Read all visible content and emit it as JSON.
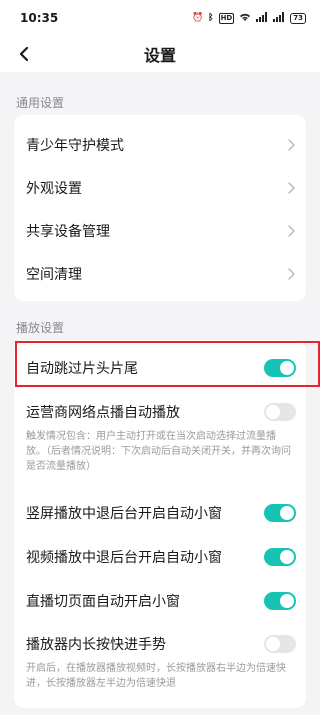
{
  "status_bar": {
    "time": "10:35",
    "net_speed": "HD",
    "signal1": "5G",
    "signal2": "5G",
    "battery": "73"
  },
  "nav": {
    "title": "设置"
  },
  "general": {
    "section_label": "通用设置",
    "items": [
      {
        "label": "青少年守护模式"
      },
      {
        "label": "外观设置"
      },
      {
        "label": "共享设备管理"
      },
      {
        "label": "空间清理"
      }
    ]
  },
  "playback": {
    "section_label": "播放设置",
    "items": [
      {
        "label": "自动跳过片头片尾",
        "on": true
      },
      {
        "label": "运营商网络点播自动播放",
        "on": false,
        "desc": "触发情况包含：用户主动打开或在当次启动选择过流量播放。（后者情况说明：下次启动后自动关闭开关，并再次询问是否流量播放）"
      },
      {
        "label": "竖屏播放中退后台开启自动小窗",
        "on": true
      },
      {
        "label": "视频播放中退后台开启自动小窗",
        "on": true
      },
      {
        "label": "直播切页面自动开启小窗",
        "on": true
      },
      {
        "label": "播放器内长按快进手势",
        "on": false,
        "desc": "开启后，在播放器播放视频时，长按播放器右半边为倍速快进，长按播放器左半边为倍速快退"
      }
    ]
  },
  "colors": {
    "accent": "#17c3b2",
    "highlight": "#e4262a"
  }
}
